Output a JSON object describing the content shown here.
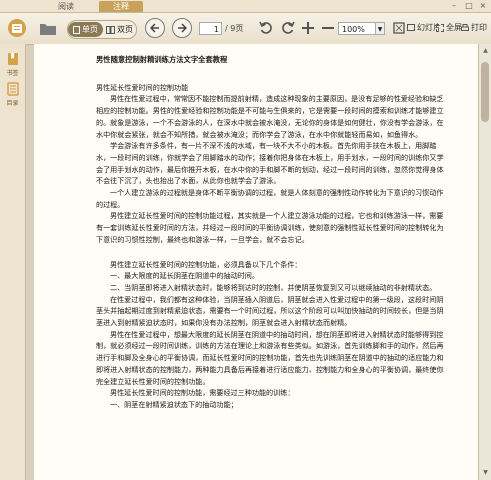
{
  "tabs": [
    "阅读",
    "注释"
  ],
  "window_controls": [
    "–",
    "□",
    "×"
  ],
  "toolbar": {
    "single_page": "单页",
    "double_page": "双页",
    "prev": "‹",
    "next": "›",
    "page_current": "1",
    "page_total": "/ 9页",
    "zoom": "100%",
    "slideshow": "幻灯片",
    "fullscreen": "全屏",
    "print": "打印"
  },
  "sidebar": {
    "items": [
      {
        "label": "书签",
        "icon": "bookmark-icon"
      },
      {
        "label": "目录",
        "icon": "contents-icon"
      }
    ]
  },
  "document": {
    "title": "男性随意控制射精训练方法文字全套教程",
    "paragraphs": [
      {
        "indent": false,
        "text": "男性延长性爱时间的控制功能"
      },
      {
        "indent": true,
        "text": "男性在性爱过程中，常常因不能控制而提前射精，造成这种现象的主要原因，是没有足够的性爱经验和缺乏相应的控制功能。男性的性爱经验和控制功能是不可能与生俱来的，它是需要一段时间的摸索和训练才能够建立的。就象是游泳，一个不会游泳的人，在深水中就会被水淹没，无论你的身体是如何健壮，你没有学会游泳，在水中你就会紧张，就会不知所措，就会被水淹没；而你学会了游泳，在水中你就能轻而易如，如鱼得水。"
      },
      {
        "indent": true,
        "text": "学会游泳有许多条件，有一片不深不浅的水域，有一块不大不小的木板。首先你用手扶在木板上，用脚踏水，一段时间的训练，你就学会了用脚踏水的动作；接着你把身体在木板上，用手划水，一段时间的训练你又学会了用手划水的动作，最后你推开木板，在水中你的手和脚不断的划动，经过一段时间的训练，忽然你觉得身体不会往下沉了，头也抬出了水面，从此你也就学会了游泳。"
      },
      {
        "indent": true,
        "text": "一个人建立游泳的过程就是身体不断平衡协调的过程，就是人体刻意的强制性动作转化为下意识的习惯动作的过程。"
      },
      {
        "indent": true,
        "text": "男性建立延长性爱时间的控制功能过程，其实就是一个人建立游泳功能的过程，它也和训练游泳一样，需要有一套训练延长性爱时间的方法，并经过一段时间的平衡协调训练，使刻意的强制性延长性爱时间的控制转化为下意识的习惯性控制，最终也和游泳一样，一旦学会，就不会忘记。"
      },
      {
        "gap": true
      },
      {
        "indent": true,
        "text": "男性建立延长性爱时间的控制功能，必须具备以下几个条件："
      },
      {
        "indent": true,
        "text": "一、最大限度的延长阴茎在阴道中的抽动时间。"
      },
      {
        "indent": true,
        "text": "二、当阴茎即将进入射精状态时，能够将到达时的控制，并使阴茎恢复到又可以继续抽动的非射精状态。"
      },
      {
        "indent": true,
        "text": "在性爱过程中，我们都有这种体验，当阴茎插入阴道后，阴茎就会进入性爱过程中的第一级段，这段时间阴茎头并抽起期过度到射精紧迫状态，需要有一个时间过程，所以这个阶段可以叫加快抽动的时间较长，但是当阴茎进入到射精紧迫状态时，如果你没有办法控制，阴茎就会进入射精状态而射精。"
      },
      {
        "indent": true,
        "text": "男性在性爱过程中，想最大限度的延长阴茎在阴道中的抽动时间，想在阴茎即将进入射精状态时能够得到控制，就必须经过一段时间训练，训练的方法在理论上和游泳有些类似。如游泳，首先训练脚和手的动作，然后再进行手和脚及全身心的平衡协调，而延长性爱时间的控制功能，首先也先训练阴茎在阴道中的抽动的适应能力和即将进入射精状态的控制能力，两种能力具备后再接着进行适应能力、控制能力和全身心的平衡协调，最终使你完全建立延长性爱时间的控制功能。"
      },
      {
        "indent": true,
        "text": "男性延长性爱时间的控制功能，需要经过三种功能的训练："
      },
      {
        "indent": true,
        "text": "一、阴茎在射精紧迫状态下的抽动功能；"
      }
    ]
  }
}
